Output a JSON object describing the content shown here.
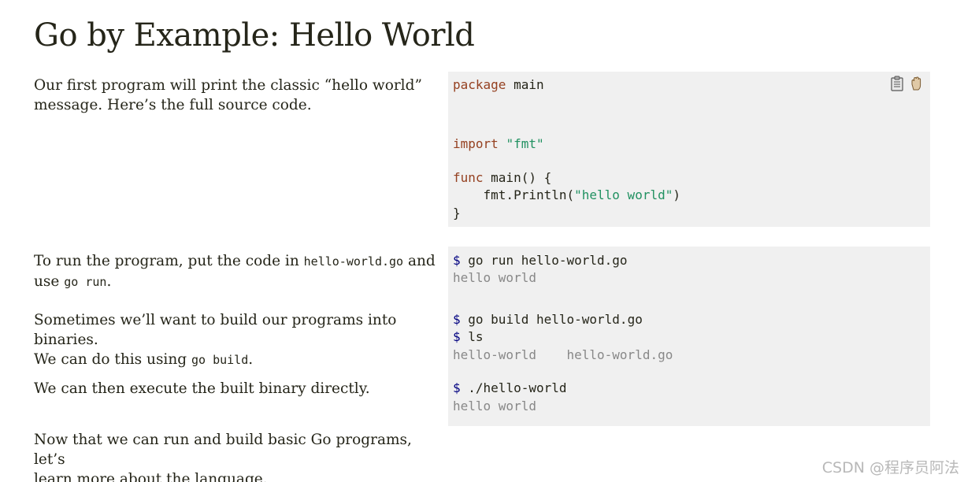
{
  "page": {
    "title": "Go by Example: Hello World"
  },
  "sections": {
    "intro": {
      "text_1": "Our first program will print the classic “hello world”",
      "text_2": "message. Here’s the full source code."
    },
    "run": {
      "text_1": "To run the program, put the code in ",
      "code_1": "hello-world.go",
      "text_2": " and",
      "text_3": "use ",
      "code_2": "go run",
      "text_4": "."
    },
    "build": {
      "text_1": "Sometimes we’ll want to build our programs into binaries.",
      "text_2": "We can do this using ",
      "code_1": "go build",
      "text_3": "."
    },
    "execute": {
      "text_1": "We can then execute the built binary directly."
    },
    "conclusion": {
      "text_1": "Now that we can run and build basic Go programs, let’s",
      "text_2": "learn more about the language."
    }
  },
  "source_code": {
    "package_kw": "package",
    "package_name": " main",
    "import_kw": "import",
    "import_path": "\"fmt\"",
    "func_kw": "func",
    "func_sig": " main() {",
    "println_call": "    fmt.Println(",
    "println_arg": "\"hello world\"",
    "println_close": ")",
    "closing_brace": "}"
  },
  "shell": {
    "prompt": "$",
    "cmd_run": " go run hello-world.go",
    "out_run": "hello world",
    "cmd_build": " go build hello-world.go",
    "cmd_ls": " ls",
    "out_ls": "hello-world    hello-world.go",
    "cmd_exec": " ./hello-world",
    "out_exec": "hello world"
  },
  "icons": {
    "copy": "clipboard-icon",
    "run": "hand-icon"
  },
  "watermark": "CSDN @程序员阿法",
  "colors": {
    "keyword": "#954121",
    "string": "#219161",
    "output": "#888888",
    "prompt": "#000080",
    "code_bg": "#f0f0f0"
  }
}
